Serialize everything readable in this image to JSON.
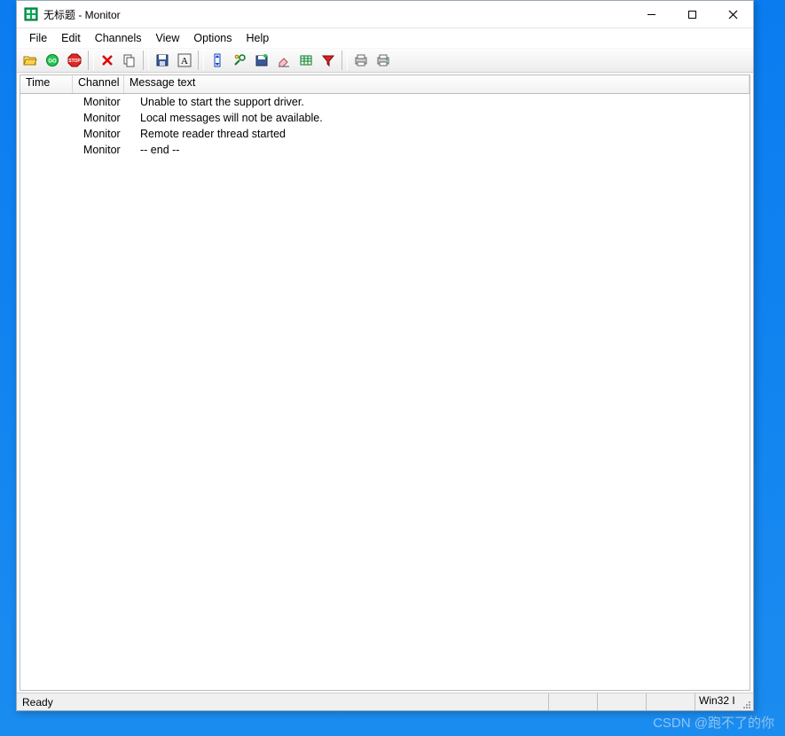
{
  "window": {
    "title": "无标题 - Monitor"
  },
  "menubar": {
    "items": [
      "File",
      "Edit",
      "Channels",
      "View",
      "Options",
      "Help"
    ]
  },
  "columns": {
    "time": "Time",
    "channel": "Channel",
    "message": "Message text"
  },
  "rows": [
    {
      "time": "",
      "channel": "Monitor",
      "message": "Unable to start the support driver."
    },
    {
      "time": "",
      "channel": "Monitor",
      "message": "Local messages will not be available."
    },
    {
      "time": "",
      "channel": "Monitor",
      "message": "Remote reader thread started"
    },
    {
      "time": "",
      "channel": "Monitor",
      "message": " -- end --"
    }
  ],
  "statusbar": {
    "ready": "Ready",
    "mode": "Win32 I"
  },
  "watermark": "CSDN @跑不了的你"
}
